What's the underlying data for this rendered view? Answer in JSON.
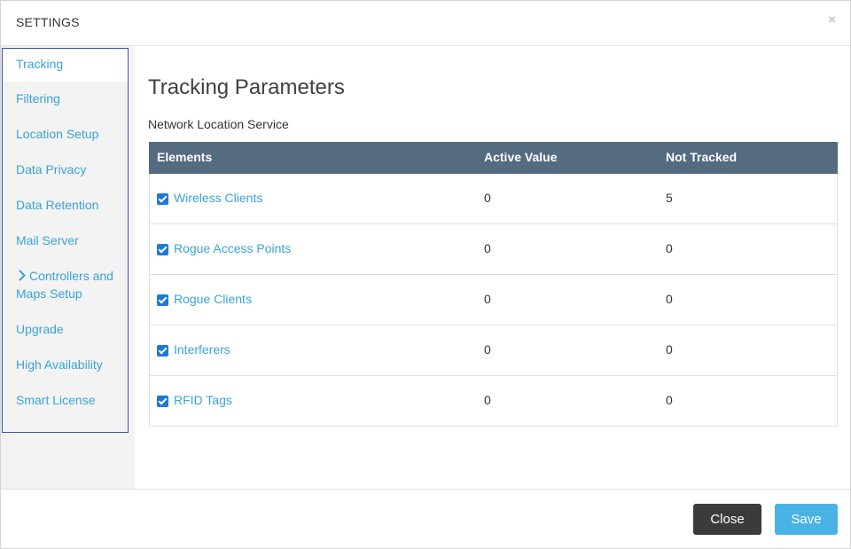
{
  "modal": {
    "title": "SETTINGS",
    "close_symbol": "×"
  },
  "sidebar": {
    "items": [
      {
        "label": "Tracking",
        "active": true
      },
      {
        "label": "Filtering"
      },
      {
        "label": "Location Setup"
      },
      {
        "label": "Data Privacy"
      },
      {
        "label": "Data Retention"
      },
      {
        "label": "Mail Server"
      },
      {
        "label_line1": "Controllers and",
        "label_line2": "Maps Setup",
        "icon": "chevron-right-icon"
      },
      {
        "label": "Upgrade"
      },
      {
        "label": "High Availability"
      },
      {
        "label": "Smart License"
      }
    ]
  },
  "main": {
    "title": "Tracking Parameters",
    "section": "Network Location Service",
    "table": {
      "headers": [
        "Elements",
        "Active Value",
        "Not Tracked"
      ],
      "rows": [
        {
          "name": "Wireless Clients",
          "checked": true,
          "active": "0",
          "not_tracked": "5"
        },
        {
          "name": "Rogue Access Points",
          "checked": true,
          "active": "0",
          "not_tracked": "0"
        },
        {
          "name": "Rogue Clients",
          "checked": true,
          "active": "0",
          "not_tracked": "0"
        },
        {
          "name": "Interferers",
          "checked": true,
          "active": "0",
          "not_tracked": "0"
        },
        {
          "name": "RFID Tags",
          "checked": true,
          "active": "0",
          "not_tracked": "0"
        }
      ]
    }
  },
  "footer": {
    "close_label": "Close",
    "save_label": "Save"
  },
  "colors": {
    "accent": "#3aa3d6",
    "header_bg": "#546b80",
    "close_btn": "#3b3b3b",
    "save_btn": "#4ab3e6",
    "checkbox": "#1e78d6"
  }
}
